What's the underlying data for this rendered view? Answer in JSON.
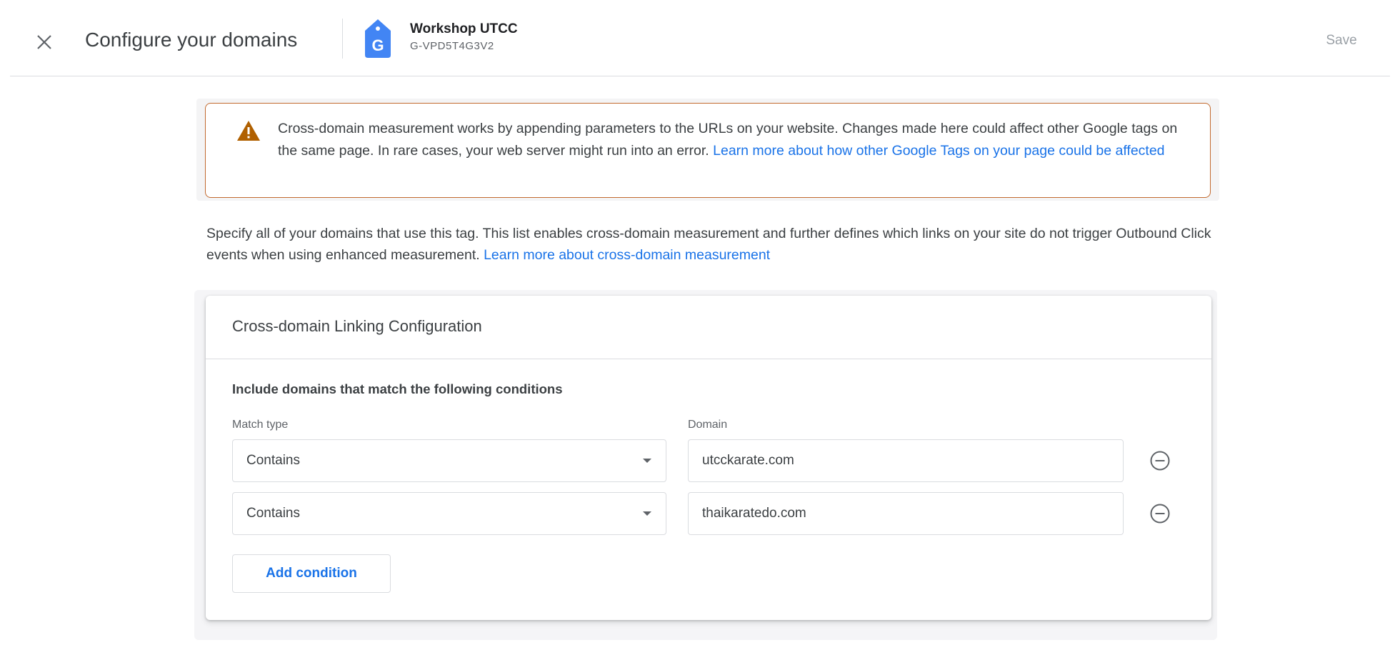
{
  "header": {
    "title": "Configure your domains",
    "tag_name": "Workshop UTCC",
    "tag_id": "G-VPD5T4G3V2",
    "save_label": "Save"
  },
  "warning": {
    "text": "Cross-domain measurement works by appending parameters to the URLs on your website. Changes made here could affect other Google tags on the same page. In rare cases, your web server might run into an error. ",
    "link": "Learn more about how other Google Tags on your page could be affected"
  },
  "description": {
    "text": "Specify all of your domains that use this tag. This list enables cross-domain measurement and further defines which links on your site do not trigger Outbound Click events when using enhanced measurement. ",
    "link": "Learn more about cross-domain measurement"
  },
  "card": {
    "title": "Cross-domain Linking Configuration",
    "section_label": "Include domains that match the following conditions",
    "match_type_label": "Match type",
    "domain_label": "Domain",
    "conditions": [
      {
        "match_type": "Contains",
        "domain": "utcckarate.com"
      },
      {
        "match_type": "Contains",
        "domain": "thaikaratedo.com"
      }
    ],
    "add_condition_label": "Add condition"
  },
  "colors": {
    "accent": "#1a73e8",
    "warning_border": "#c26a2f",
    "warning_icon": "#b06000",
    "tag_icon": "#4285f4"
  },
  "icons": {
    "close": "close-icon",
    "tag": "google-tag-icon",
    "warning": "warning-icon",
    "remove": "remove-circle-icon",
    "dropdown": "dropdown-arrow-icon"
  }
}
